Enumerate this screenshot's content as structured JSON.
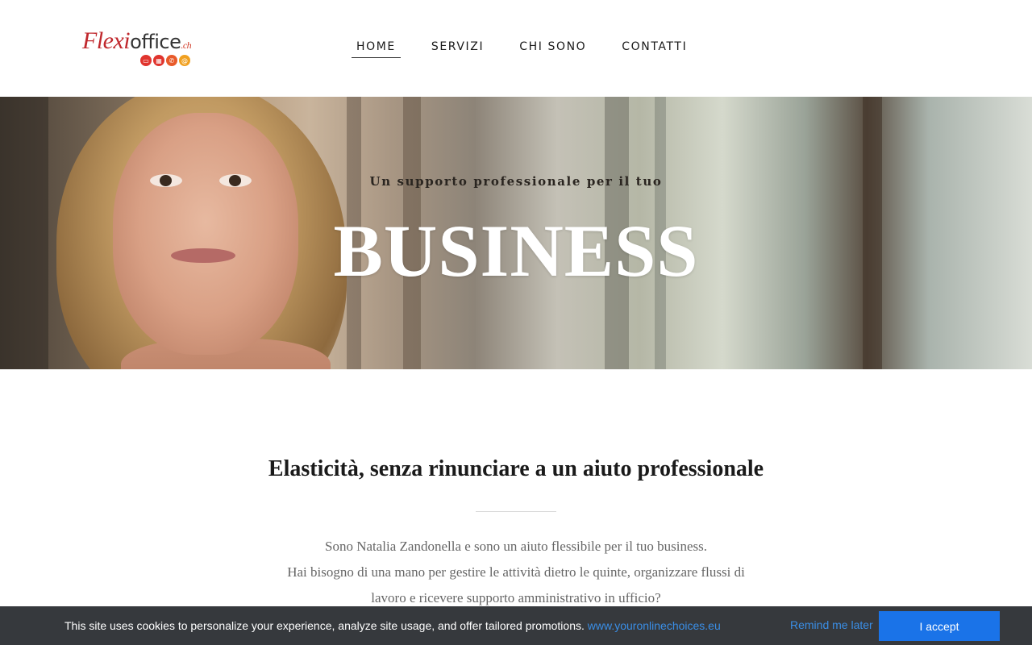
{
  "header": {
    "logo": {
      "brand": "Flexi",
      "office": "office",
      "tld": ".ch"
    },
    "nav": [
      {
        "label": "HOME",
        "active": true
      },
      {
        "label": "SERVIZI",
        "active": false
      },
      {
        "label": "CHI SONO",
        "active": false
      },
      {
        "label": "CONTATTI",
        "active": false
      }
    ]
  },
  "hero": {
    "subtitle": "Un supporto professionale per il tuo",
    "title": "BUSINESS"
  },
  "main": {
    "heading": "Elasticità, senza rinunciare a un aiuto professionale",
    "paragraph_lines": [
      "Sono Natalia Zandonella e sono un aiuto flessibile per il tuo business.",
      "Hai bisogno di una mano per gestire le attività dietro le quinte, organizzare flussi di",
      "lavoro e ricevere supporto amministrativo in ufficio?"
    ]
  },
  "cookie_bar": {
    "message": "This site uses cookies to personalize your experience, analyze site usage, and offer tailored promotions.",
    "link_text": "www.youronlinechoices.eu",
    "remind_label": "Remind me later",
    "accept_label": "I accept"
  },
  "colors": {
    "accent_blue": "#1a73e8",
    "link_blue": "#3a8ee6",
    "cookie_bg": "#36393d",
    "logo_red": "#c0282d"
  },
  "icons": [
    "monitor-icon",
    "calculator-icon",
    "phone-icon",
    "at-icon"
  ]
}
